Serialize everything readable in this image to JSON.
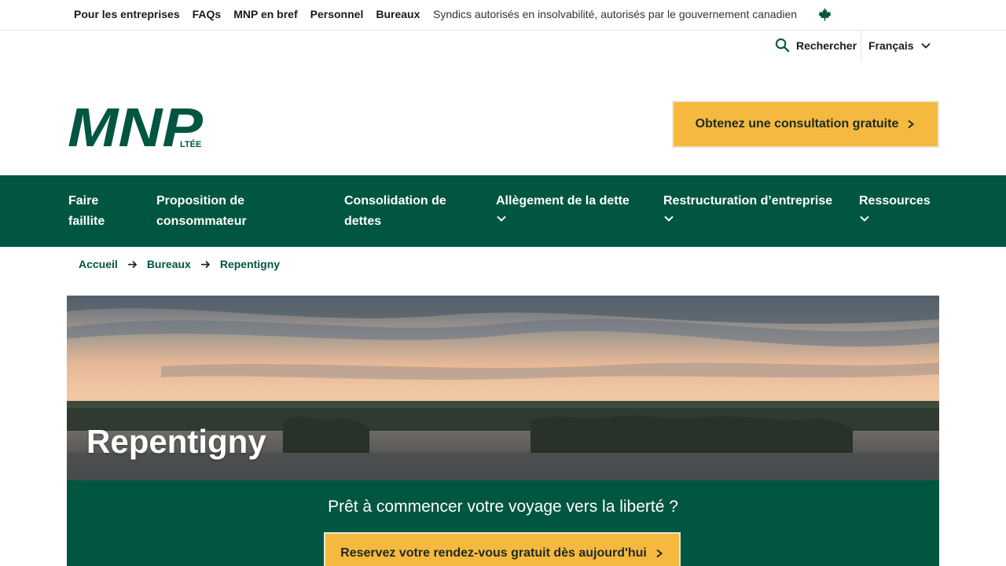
{
  "utility": {
    "links": [
      "Pour les entreprises",
      "FAQs",
      "MNP en bref",
      "Personnel",
      "Bureaux"
    ],
    "trustee_text": "Syndics autorisés en insolvabilité, autorisés par le gouvernement canadien",
    "maple_icon": "maple-leaf-icon"
  },
  "search": {
    "label": "Rechercher",
    "icon": "search-icon"
  },
  "language": {
    "label": "Français",
    "icon": "chevron-down-icon"
  },
  "logo": {
    "name": "MNP",
    "suffix": "LTÉE",
    "color": "#005640"
  },
  "header_cta": {
    "label": "Obtenez une consultation gratuite",
    "icon": "chevron-right-icon"
  },
  "nav": {
    "items": [
      {
        "label_line1": "Faire",
        "label_line2": "faillite",
        "has_dropdown": false
      },
      {
        "label_line1": "Proposition de",
        "label_line2": "consommateur",
        "has_dropdown": false
      },
      {
        "label_line1": "Consolidation de",
        "label_line2": "dettes",
        "has_dropdown": false
      },
      {
        "label_line1": "Allègement de la dette",
        "label_line2": "",
        "has_dropdown": true
      },
      {
        "label_line1": "Restructuration d’entreprise",
        "label_line2": "",
        "has_dropdown": true
      },
      {
        "label_line1": "Ressources",
        "label_line2": "",
        "has_dropdown": true
      }
    ]
  },
  "breadcrumb": {
    "items": [
      "Accueil",
      "Bureaux",
      "Repentigny"
    ]
  },
  "hero": {
    "title": "Repentigny"
  },
  "cta_band": {
    "text": "Prêt à commencer votre voyage vers la liberté ?",
    "button_label": "Reservez votre rendez-vous gratuit dès aujourd'hui"
  },
  "colors": {
    "brand_green": "#005640",
    "cta_yellow": "#f5b93f"
  }
}
